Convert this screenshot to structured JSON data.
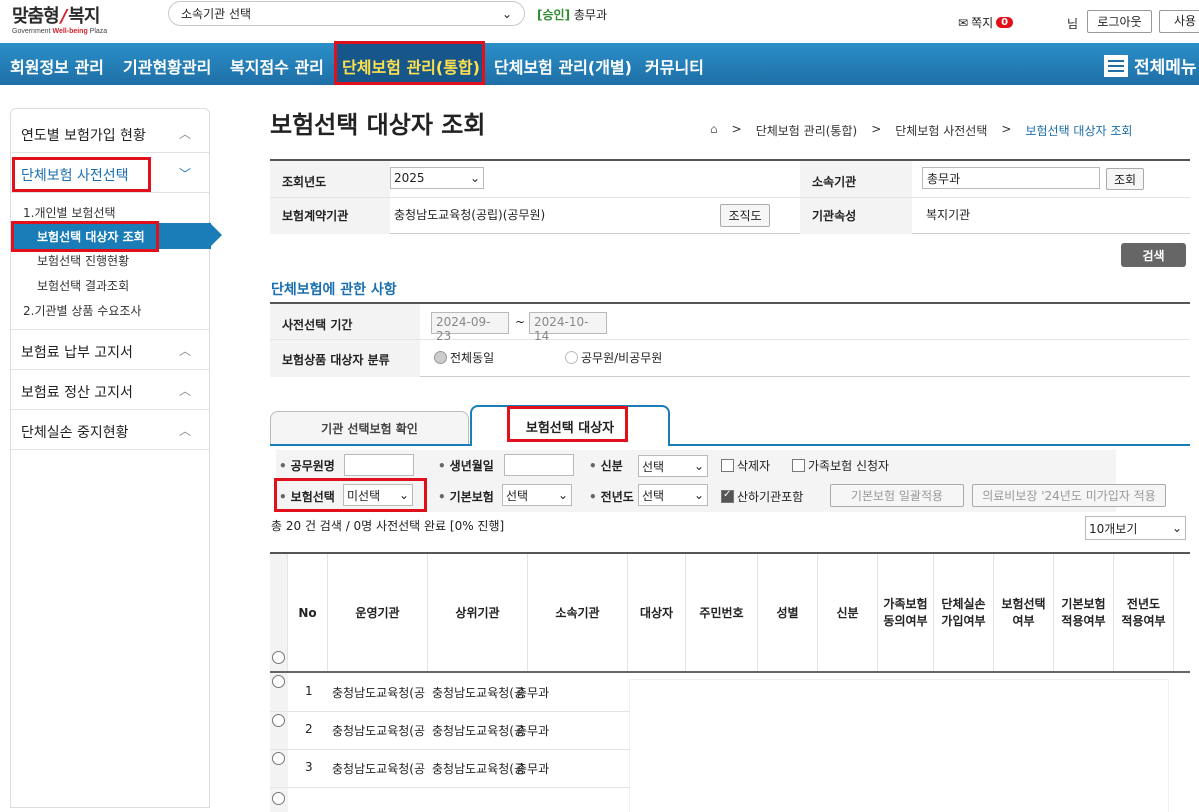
{
  "header": {
    "logo_main": "맞춤형",
    "logo_slash": "/",
    "logo_right": "복지",
    "logo_sub_a": "Government ",
    "logo_sub_b": "Well-being",
    "logo_sub_c": " Plaza",
    "org_select_value": "소속기관 선택",
    "approval_tag": "[승인]",
    "approval_org": "총무과",
    "note_label": "쪽지",
    "note_count": "0",
    "nim": "님",
    "logout_label": "로그아웃",
    "user_label": "사용"
  },
  "nav": {
    "items": [
      "회원정보 관리",
      "기관현황관리",
      "복지점수 관리",
      "단체보험 관리(통합)",
      "단체보험 관리(개별)",
      "커뮤니티"
    ],
    "menu_all": "전체메뉴"
  },
  "sidebar": {
    "groups": [
      "연도별 보험가입 현황",
      "단체보험 사전선택",
      "보험료 납부 고지서",
      "보험료 정산 고지서",
      "단체실손 중지현황"
    ],
    "sub_items": [
      "1.개인별 보험선택",
      "보험선택 대상자 조회",
      "보험선택 진행현황",
      "보험선택 결과조회",
      "2.기관별 상품 수요조사"
    ]
  },
  "page": {
    "title": "보험선택 대상자 조회",
    "breadcrumb": [
      "단체보험 관리(통합)",
      "단체보험 사전선택",
      "보험선택 대상자 조회"
    ]
  },
  "filter": {
    "year_label": "조회년도",
    "year_value": "2025",
    "org_label": "소속기관",
    "org_value": "총무과",
    "lookup_btn": "조회",
    "contract_label": "보험계약기관",
    "contract_value": "충청남도교육청(공립)(공무원)",
    "orgchart_btn": "조직도",
    "attr_label": "기관속성",
    "attr_value": "복지기관",
    "search_btn": "검색"
  },
  "section": {
    "title": "단체보험에 관한 사항",
    "period_label": "사전선택 기간",
    "period_from": "2024-09-23",
    "period_tilde": "~",
    "period_to": "2024-10-14",
    "target_label": "보험상품 대상자 분류",
    "opt1": "전체동일",
    "opt2": "공무원/비공무원"
  },
  "tabs": [
    "기관 선택보험 확인",
    "보험선택 대상자"
  ],
  "search_form": {
    "name_label": "공무원명",
    "birth_label": "생년월일",
    "status_label": "신분",
    "status_value": "선택",
    "deleted_label": "삭제자",
    "family_label": "가족보험 신청자",
    "ins_select_label": "보험선택",
    "ins_select_value": "미선택",
    "basic_label": "기본보험",
    "basic_value": "선택",
    "prev_label": "전년도",
    "prev_value": "선택",
    "sub_org_label": "산하기관포함",
    "btn_apply_all": "기본보험 일괄적용",
    "btn_medical": "의료비보장 '24년도 미가입자 적용"
  },
  "summary": {
    "text": "총 20 건 검색 / 0명 사전선택 완료 [0% 진행]",
    "page_size": "10개보기"
  },
  "grid": {
    "headers": [
      "No",
      "운영기관",
      "상위기관",
      "소속기관",
      "대상자",
      "주민번호",
      "성별",
      "신분",
      "가족보험\n동의여부",
      "단체실손\n가입여부",
      "보험선택\n여부",
      "기본보험\n적용여부",
      "전년도\n적용여부"
    ],
    "rows": [
      {
        "no": "1",
        "op": "충청남도교육청(공",
        "up": "충청남도교육청(공",
        "org": "총무과"
      },
      {
        "no": "2",
        "op": "충청남도교육청(공",
        "up": "충청남도교육청(공",
        "org": "총무과"
      },
      {
        "no": "3",
        "op": "충청남도교육청(공",
        "up": "충청남도교육청(공",
        "org": "총무과"
      }
    ]
  },
  "colors": {
    "nav_blue": "#1f6fa6",
    "accent_red": "#e0101d",
    "active_yellow": "#ffe14d"
  }
}
